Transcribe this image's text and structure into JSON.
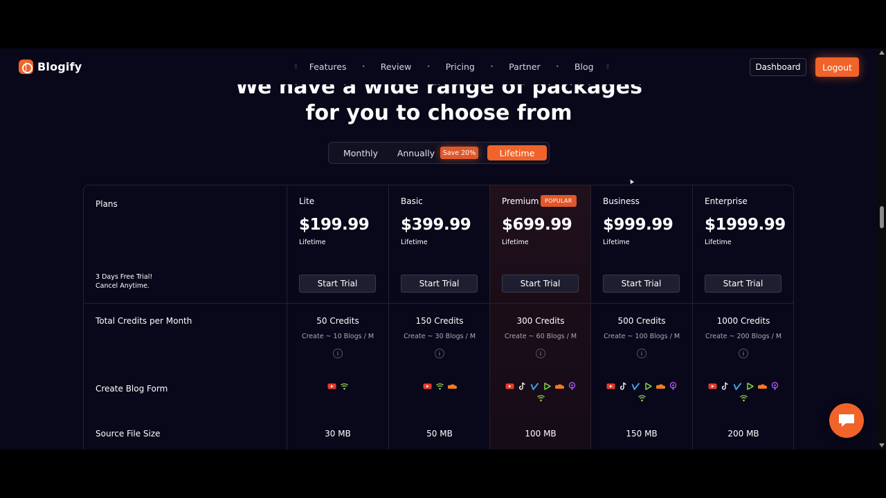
{
  "brand": {
    "name": "Blogify",
    "accent": "#f0632a"
  },
  "nav": {
    "links": [
      "Features",
      "Review",
      "Pricing",
      "Partner",
      "Blog"
    ],
    "dashboard_label": "Dashboard",
    "logout_label": "Logout"
  },
  "hero": {
    "line1": "We have a wide range of packages",
    "line2": "for you to choose from"
  },
  "billing_toggle": {
    "monthly": "Monthly",
    "annually": "Annually",
    "save_badge": "Save 20%",
    "lifetime": "Lifetime",
    "selected": "Lifetime"
  },
  "table": {
    "plans_label": "Plans",
    "trial_note_line1": "3 Days Free Trial!",
    "trial_note_line2": "Cancel Anytime.",
    "plans": [
      {
        "name": "Lite",
        "price": "$199.99",
        "period": "Lifetime",
        "cta": "Start Trial",
        "credits": "50 Credits",
        "blogs": "Create ~ 10 Blogs / M",
        "source_size": "30 MB",
        "forms": [
          "youtube",
          "podcast"
        ]
      },
      {
        "name": "Basic",
        "price": "$399.99",
        "period": "Lifetime",
        "cta": "Start Trial",
        "credits": "150 Credits",
        "blogs": "Create ~ 30 Blogs / M",
        "source_size": "50 MB",
        "forms": [
          "youtube",
          "podcast",
          "soundcloud"
        ]
      },
      {
        "name": "Premium",
        "badge": "POPULAR",
        "price": "$699.99",
        "period": "Lifetime",
        "cta": "Start Trial",
        "credits": "300 Credits",
        "blogs": "Create ~ 60 Blogs / M",
        "source_size": "100 MB",
        "forms": [
          "youtube",
          "tiktok",
          "vimeo",
          "rumble",
          "soundcloud",
          "apple-podcast",
          "podcast"
        ]
      },
      {
        "name": "Business",
        "price": "$999.99",
        "period": "Lifetime",
        "cta": "Start Trial",
        "credits": "500 Credits",
        "blogs": "Create ~ 100 Blogs / M",
        "source_size": "150 MB",
        "forms": [
          "youtube",
          "tiktok",
          "vimeo",
          "rumble",
          "soundcloud",
          "apple-podcast",
          "podcast"
        ]
      },
      {
        "name": "Enterprise",
        "price": "$1999.99",
        "period": "Lifetime",
        "cta": "Start Trial",
        "credits": "1000 Credits",
        "blogs": "Create ~ 200 Blogs / M",
        "source_size": "200 MB",
        "forms": [
          "youtube",
          "tiktok",
          "vimeo",
          "rumble",
          "soundcloud",
          "apple-podcast",
          "podcast"
        ]
      }
    ],
    "feature_labels": {
      "credits": "Total Credits per Month",
      "blog_form": "Create Blog Form",
      "source_size": "Source File Size"
    },
    "info_glyph": "i"
  },
  "icons": {
    "youtube": "#e53b2c",
    "tiktok": "#ffffff",
    "vimeo": "#3aa4e8",
    "rumble": "#7ac943",
    "soundcloud": "#f47a20",
    "apple-podcast": "#a855f7",
    "podcast": "#8bc34a"
  }
}
